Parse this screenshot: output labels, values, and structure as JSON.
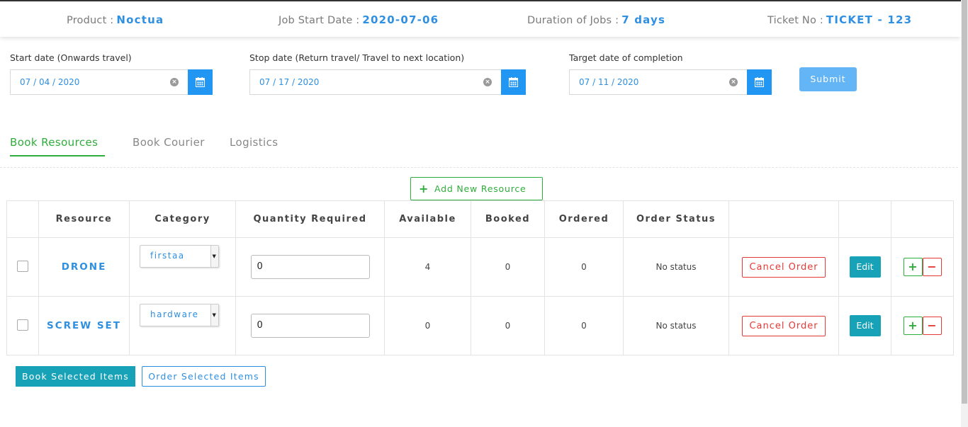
{
  "header": {
    "product_label": "Product :",
    "product_value": "Noctua",
    "job_start_label": "Job Start Date :",
    "job_start_value": "2020-07-06",
    "duration_label": "Duration of Jobs :",
    "duration_value": "7 days",
    "ticket_label": "Ticket No :",
    "ticket_value": "TICKET - 123"
  },
  "dates": {
    "start_label": "Start date (Onwards travel)",
    "start_value": "07 / 04 / 2020",
    "stop_label": "Stop date (Return travel/ Travel to next location)",
    "stop_value": "07 / 17 / 2020",
    "target_label": "Target date of completion",
    "target_value": "07 / 11 / 2020",
    "submit_label": "Submit"
  },
  "tabs": [
    {
      "label": "Book Resources",
      "active": true
    },
    {
      "label": "Book Courier",
      "active": false
    },
    {
      "label": "Logistics",
      "active": false
    }
  ],
  "add_resource_label": "Add New Resource",
  "table": {
    "headers": [
      "Resource",
      "Category",
      "Quantity Required",
      "Available",
      "Booked",
      "Ordered",
      "Order Status"
    ],
    "rows": [
      {
        "resource": "DRONE",
        "category": "firstaa",
        "quantity": "0",
        "available": "4",
        "booked": "0",
        "ordered": "0",
        "status": "No status",
        "cancel_label": "Cancel Order",
        "edit_label": "Edit"
      },
      {
        "resource": "SCREW SET",
        "category": "hardware",
        "quantity": "0",
        "available": "0",
        "booked": "0",
        "ordered": "0",
        "status": "No status",
        "cancel_label": "Cancel Order",
        "edit_label": "Edit"
      }
    ]
  },
  "footer": {
    "book_selected_label": "Book Selected Items",
    "order_selected_label": "Order Selected Items"
  },
  "colors": {
    "accent_blue": "#2f8fe0",
    "green": "#2eae3a",
    "red": "#e53935",
    "teal": "#17a2b8"
  },
  "icons": [
    "calendar-icon",
    "clear-icon",
    "plus-icon",
    "minus-icon",
    "chevron-down-icon"
  ]
}
